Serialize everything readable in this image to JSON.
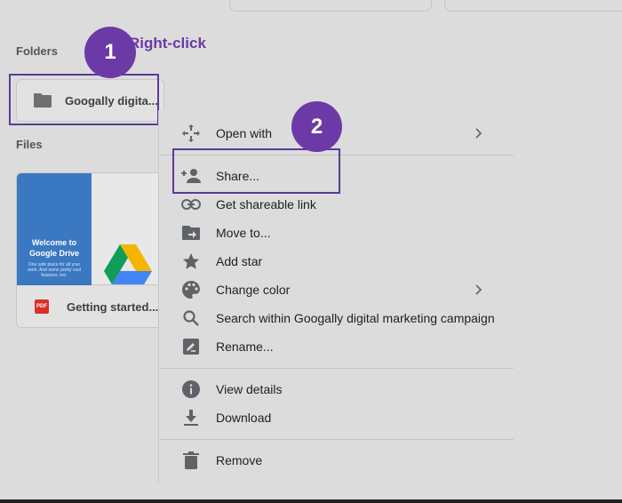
{
  "sections": {
    "folders_label": "Folders",
    "files_label": "Files"
  },
  "folder": {
    "name": "Googally digita..."
  },
  "file": {
    "name": "Getting started...",
    "file_type": "PDF",
    "thumb_title": "Welcome to Google Drive",
    "thumb_tagline": "One safe place for all your work. And some pretty cool features, too."
  },
  "annotations": {
    "step1": "1",
    "step1_label": "Right-click",
    "step2": "2",
    "accent_color": "#6c3aa6"
  },
  "menu": {
    "items": [
      {
        "label": "Open with",
        "icon": "open-with-icon",
        "has_submenu": true
      },
      {
        "label": "Share...",
        "icon": "person-add-icon"
      },
      {
        "label": "Get shareable link",
        "icon": "link-icon"
      },
      {
        "label": "Move to...",
        "icon": "move-to-folder-icon"
      },
      {
        "label": "Add star",
        "icon": "star-icon"
      },
      {
        "label": "Change color",
        "icon": "palette-icon",
        "has_submenu": true
      },
      {
        "label": "Search within Googally digital marketing campaign",
        "icon": "search-icon"
      },
      {
        "label": "Rename...",
        "icon": "rename-icon"
      },
      {
        "label": "View details",
        "icon": "info-icon"
      },
      {
        "label": "Download",
        "icon": "download-icon"
      },
      {
        "label": "Remove",
        "icon": "trash-icon"
      }
    ]
  }
}
